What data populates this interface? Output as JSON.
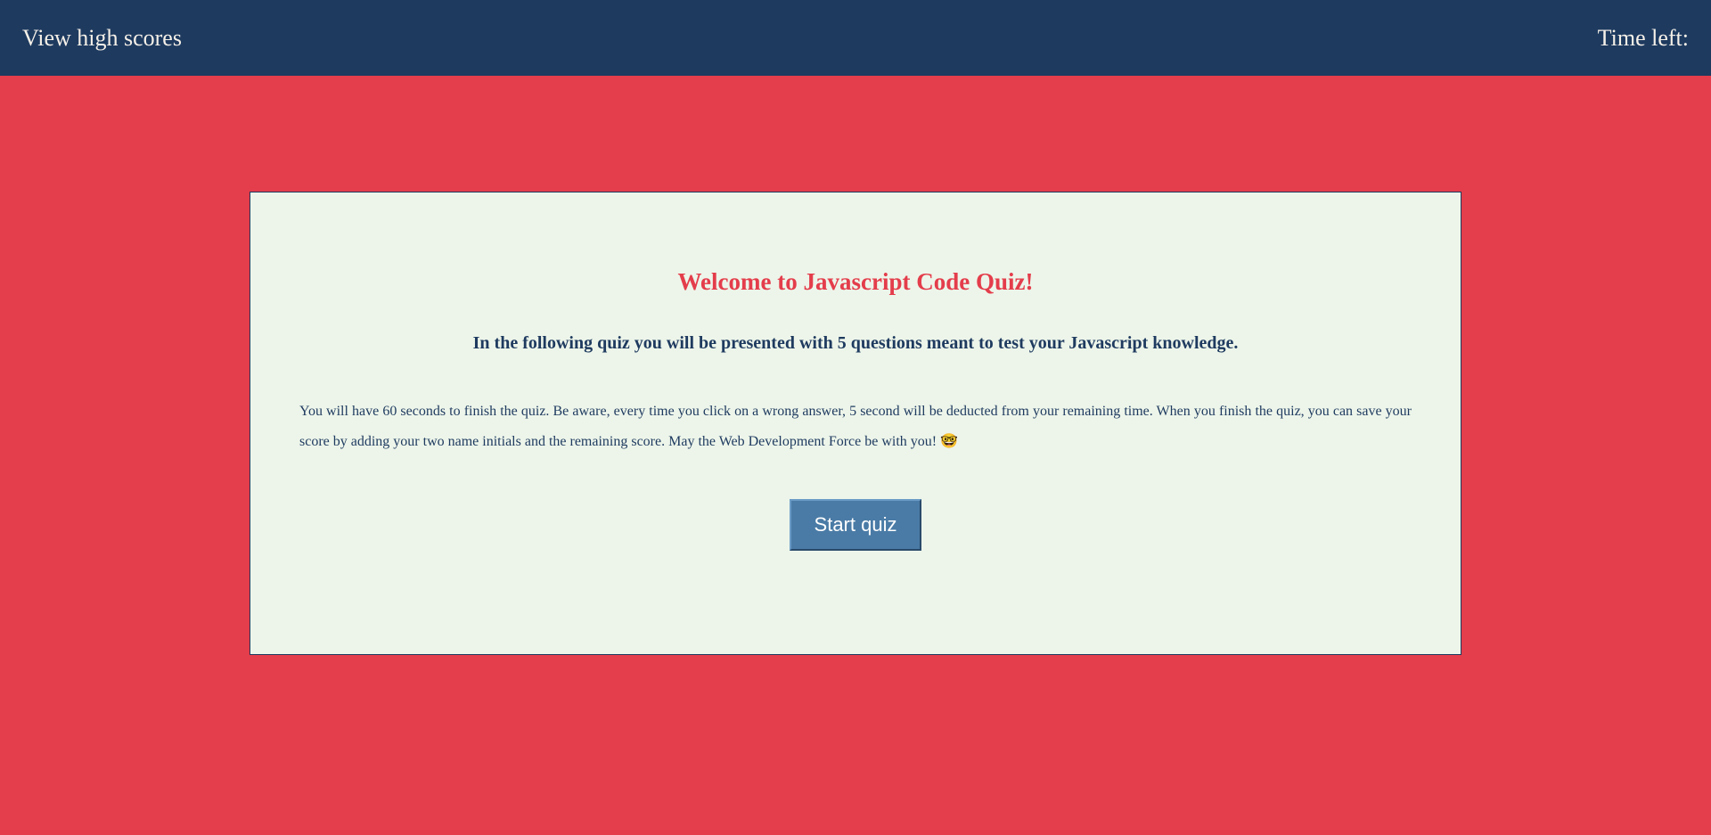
{
  "header": {
    "high_scores_label": "View high scores",
    "time_left_label": "Time left:"
  },
  "quiz_card": {
    "welcome_title": "Welcome to Javascript Code Quiz!",
    "subtitle": "In the following quiz you will be presented with 5 questions meant to test your Javascript knowledge.",
    "description": "You will have 60 seconds to finish the quiz. Be aware, every time you click on a wrong answer, 5 second will be deducted from your remaining time. When you finish the quiz, you can save your score by adding your two name initials and the remaining score. May the Web Development Force be with you! 🤓",
    "start_button_label": "Start quiz"
  }
}
